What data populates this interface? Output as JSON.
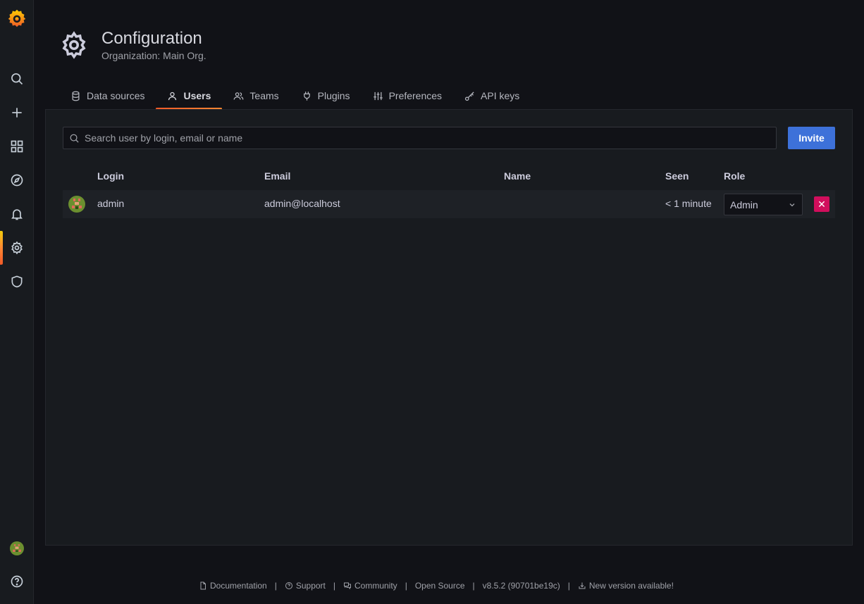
{
  "header": {
    "title": "Configuration",
    "subtitle": "Organization: Main Org."
  },
  "tabs": [
    {
      "label": "Data sources",
      "icon": "database-icon",
      "active": false
    },
    {
      "label": "Users",
      "icon": "user-icon",
      "active": true
    },
    {
      "label": "Teams",
      "icon": "users-icon",
      "active": false
    },
    {
      "label": "Plugins",
      "icon": "plug-icon",
      "active": false
    },
    {
      "label": "Preferences",
      "icon": "sliders-icon",
      "active": false
    },
    {
      "label": "API keys",
      "icon": "key-icon",
      "active": false
    }
  ],
  "search": {
    "placeholder": "Search user by login, email or name",
    "value": ""
  },
  "invite_label": "Invite",
  "table": {
    "columns": [
      "Login",
      "Email",
      "Name",
      "Seen",
      "Role"
    ],
    "rows": [
      {
        "login": "admin",
        "email": "admin@localhost",
        "name": "",
        "seen": "< 1 minute",
        "role": "Admin"
      }
    ]
  },
  "footer": {
    "items": [
      "Documentation",
      "Support",
      "Community",
      "Open Source",
      "v8.5.2 (90701be19c)",
      "New version available!"
    ]
  },
  "colors": {
    "accent": "#f05a28",
    "primary": "#3d71d9",
    "danger": "#d10e5c",
    "background": "#111217",
    "panel": "#181b1f"
  }
}
